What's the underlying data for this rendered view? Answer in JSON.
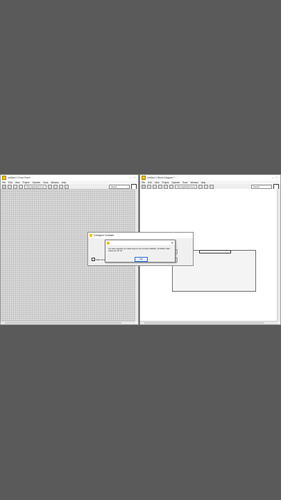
{
  "left_window": {
    "title": "Untitled 1 Front Panel",
    "menu": [
      "File",
      "Edit",
      "View",
      "Project",
      "Operate",
      "Tools",
      "Window",
      "Help"
    ],
    "font_select": "15pt Application Font",
    "search_placeholder": "Search"
  },
  "right_window": {
    "title": "Untitled 1 Block Diagram *",
    "menu": [
      "File",
      "Edit",
      "View",
      "Project",
      "Operate",
      "Tools",
      "Window",
      "Help"
    ],
    "font_select": "15pt Application Font",
    "search_placeholder": "Search"
  },
  "create_dialog": {
    "title": "Configure Constant",
    "checkbox_label": "Make Default"
  },
  "alert": {
    "message": "You have supplied an invalid value for the constant TARGET_SYSTEM. Valid values are 10, 64",
    "ok_label": "OK"
  }
}
